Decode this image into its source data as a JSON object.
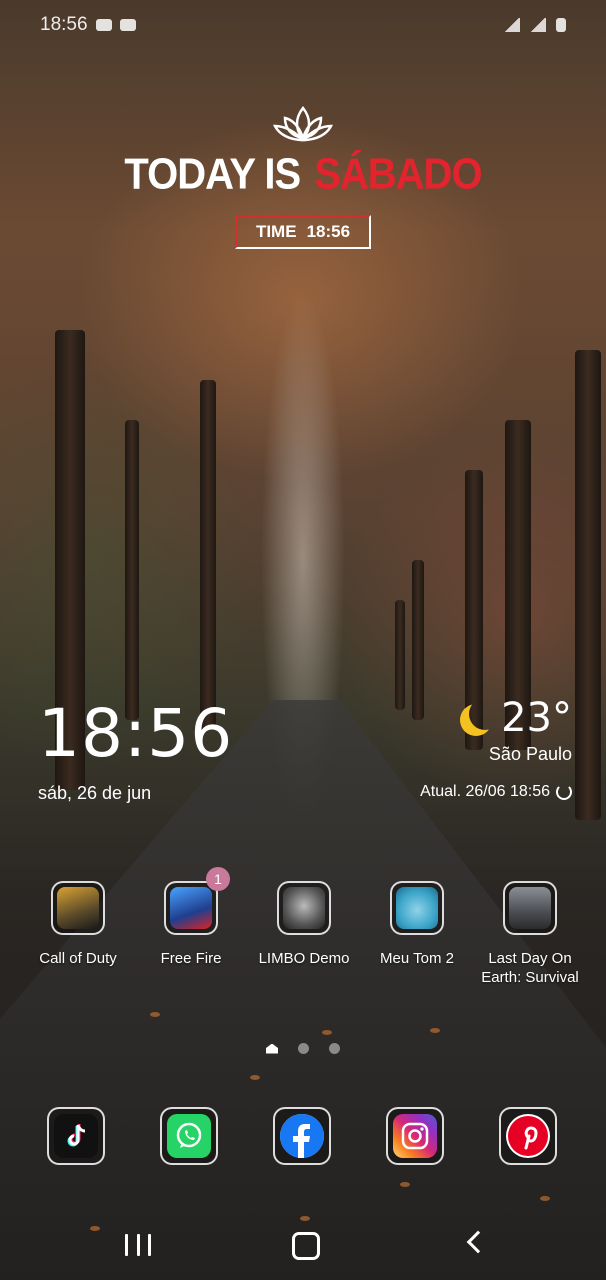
{
  "status_bar": {
    "time": "18:56"
  },
  "widget_today": {
    "prefix": "TODAY IS",
    "day": "SÁBADO",
    "time_label": "TIME",
    "time_value": "18:56"
  },
  "clock_widget": {
    "time": "18:56",
    "date": "sáb, 26 de jun"
  },
  "weather_widget": {
    "temperature": "23°",
    "city": "São Paulo",
    "updated": "Atual. 26/06 18:56",
    "icon": "moon-icon"
  },
  "apps": [
    {
      "label": "Call of Duty",
      "icon": "call-of-duty-icon"
    },
    {
      "label": "Free Fire",
      "icon": "free-fire-icon",
      "badge": "1"
    },
    {
      "label": "LIMBO Demo",
      "icon": "limbo-demo-icon"
    },
    {
      "label": "Meu Tom 2",
      "icon": "meu-tom-2-icon"
    },
    {
      "label": "Last Day On Earth: Survival",
      "icon": "last-day-on-earth-icon"
    }
  ],
  "dock": [
    {
      "name": "TikTok",
      "icon": "tiktok-icon",
      "color": "#111111"
    },
    {
      "name": "WhatsApp",
      "icon": "whatsapp-icon",
      "color": "#25d366"
    },
    {
      "name": "Facebook",
      "icon": "facebook-icon",
      "color": "#1877f2"
    },
    {
      "name": "Instagram",
      "icon": "instagram-icon",
      "color": "#d62976"
    },
    {
      "name": "Pinterest",
      "icon": "pinterest-icon",
      "color": "#e60023"
    }
  ],
  "navigation": {
    "recent": "recent-apps-icon",
    "home": "home-icon",
    "back": "back-icon"
  },
  "colors": {
    "accent_red": "#e3232e",
    "moon": "#f3c220"
  }
}
